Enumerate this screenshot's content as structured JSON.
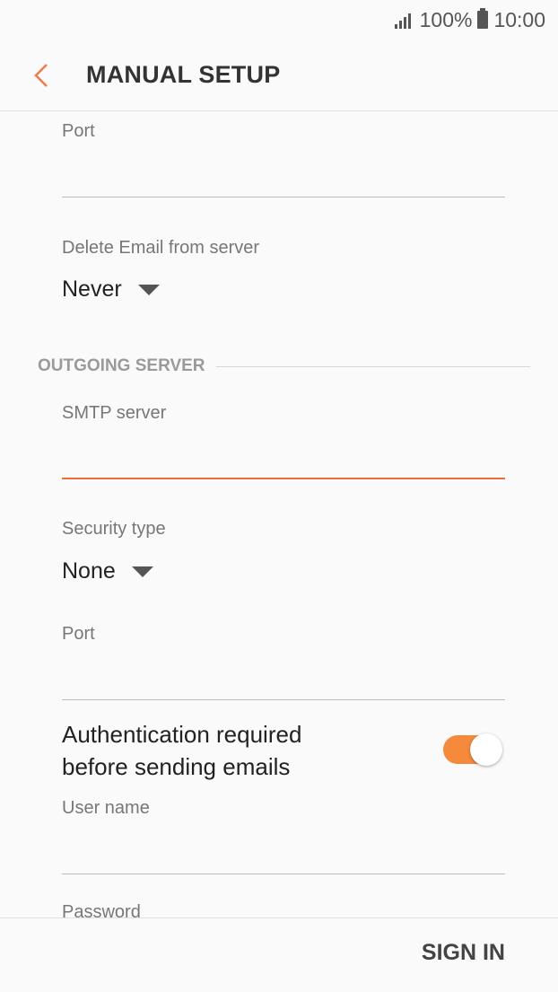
{
  "status_bar": {
    "battery": "100%",
    "time": "10:00"
  },
  "header": {
    "title": "MANUAL SETUP"
  },
  "incoming": {
    "port": {
      "label": "Port",
      "value": ""
    },
    "delete_email": {
      "label": "Delete Email from server",
      "value": "Never"
    }
  },
  "outgoing": {
    "section_title": "OUTGOING SERVER",
    "smtp_server": {
      "label": "SMTP server",
      "value": ""
    },
    "security_type": {
      "label": "Security type",
      "value": "None"
    },
    "port": {
      "label": "Port",
      "value": ""
    },
    "auth_required": {
      "label_line1": "Authentication required",
      "label_line2": "before sending emails",
      "enabled": true
    },
    "user_name": {
      "label": "User name",
      "value": ""
    },
    "password": {
      "label": "Password",
      "value": ""
    }
  },
  "footer": {
    "sign_in_label": "SIGN IN"
  },
  "colors": {
    "accent": "#f26b3a",
    "toggle_on": "#f58a3c",
    "back_arrow": "#f07a4a"
  }
}
